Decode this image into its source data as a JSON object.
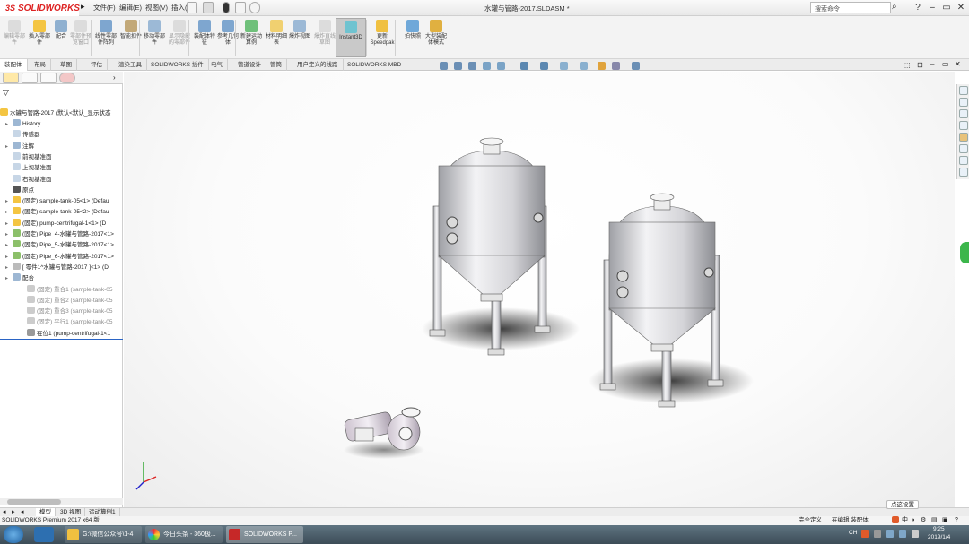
{
  "titlebar": {
    "logo_mark": "3S",
    "logo_text": "SOLIDWORKS",
    "menus": [
      "文件(F)",
      "编辑(E)",
      "视图(V)",
      "插入(I)"
    ],
    "document_title": "水罐与管路-2017.SLDASM *",
    "search_placeholder": "搜索命令",
    "window_buttons": [
      "?",
      "–",
      "▭",
      "✕"
    ]
  },
  "ribbon": {
    "buttons": [
      {
        "label": "编辑零部件",
        "enabled": false
      },
      {
        "label": "插入零部件",
        "enabled": true
      },
      {
        "label": "配合",
        "enabled": true
      },
      {
        "label": "零部件预览窗口",
        "enabled": false
      },
      {
        "label": "线性零部件阵列",
        "enabled": true
      },
      {
        "label": "智能扣件",
        "enabled": true
      },
      {
        "label": "移动零部件",
        "enabled": true
      },
      {
        "label": "显示隐藏的零部件",
        "enabled": false
      },
      {
        "label": "装配体特征",
        "enabled": true
      },
      {
        "label": "参考几何体",
        "enabled": true
      },
      {
        "label": "新建运动算例",
        "enabled": true
      },
      {
        "label": "材料明细表",
        "enabled": true
      },
      {
        "label": "爆炸视图",
        "enabled": true
      },
      {
        "label": "爆炸直线草图",
        "enabled": false
      },
      {
        "label": "Instant3D",
        "enabled": true,
        "active": true
      },
      {
        "label": "更新 Speedpak",
        "enabled": true
      },
      {
        "label": "拍快照",
        "enabled": true
      },
      {
        "label": "大型装配体模式",
        "enabled": true
      }
    ]
  },
  "tabs": [
    "装配体",
    "布局",
    "草图",
    "评估",
    "渲染工具",
    "SOLIDWORKS 插件",
    "电气",
    "管道设计",
    "管筒",
    "用户定义的线路",
    "SOLIDWORKS MBD"
  ],
  "tree": {
    "root": "水罐与管路-2017 (默认<默认_显示状态",
    "items": [
      {
        "label": "History",
        "dim": false
      },
      {
        "label": "传感器",
        "dim": false
      },
      {
        "label": "注解",
        "dim": false
      },
      {
        "label": "前视基准面",
        "dim": false
      },
      {
        "label": "上视基准面",
        "dim": false
      },
      {
        "label": "右视基准面",
        "dim": false
      },
      {
        "label": "原点",
        "dim": false
      },
      {
        "label": "(固定) sample-tank-05<1> (Defau",
        "dim": false
      },
      {
        "label": "(固定) sample-tank-05<2> (Defau",
        "dim": false
      },
      {
        "label": "(固定) pump-centrifugal-1<1> (D",
        "dim": false
      },
      {
        "label": "(固定) Pipe_4-水罐与管路-2017<1>",
        "dim": false
      },
      {
        "label": "(固定) Pipe_5-水罐与管路-2017<1>",
        "dim": false
      },
      {
        "label": "(固定) Pipe_6-水罐与管路-2017<1>",
        "dim": false
      },
      {
        "label": "[ 零件1^水罐与管路-2017 ]<1> (D",
        "dim": false
      },
      {
        "label": "配合",
        "dim": false
      },
      {
        "label": "(固定) 重合1 (sample-tank-05",
        "dim": true
      },
      {
        "label": "(固定) 重合2 (sample-tank-05",
        "dim": true
      },
      {
        "label": "(固定) 重合3 (sample-tank-05",
        "dim": true
      },
      {
        "label": "(固定) 平行1 (sample-tank-05",
        "dim": true
      },
      {
        "label": "在位1 (pump-centrifugal-1<1",
        "dim": false
      }
    ]
  },
  "bottom_tabs": [
    "模型",
    "3D 视图",
    "运动算例1"
  ],
  "status": {
    "left": "SOLIDWORKS Premium 2017 x64 版",
    "state1": "完全定义",
    "state2": "在编辑 装配体",
    "tooltip": "点这设置"
  },
  "taskbar": {
    "items": [
      "G:\\微信公众号\\1-4",
      "今日头条 - 360极...",
      "SOLIDWORKS P..."
    ],
    "time": "9:25",
    "date": "2019/1/4",
    "ime": "CH"
  },
  "colors": {
    "brand_red": "#d2232a",
    "accent_green": "#3cb64b",
    "taskbar": "#3c4c57"
  }
}
